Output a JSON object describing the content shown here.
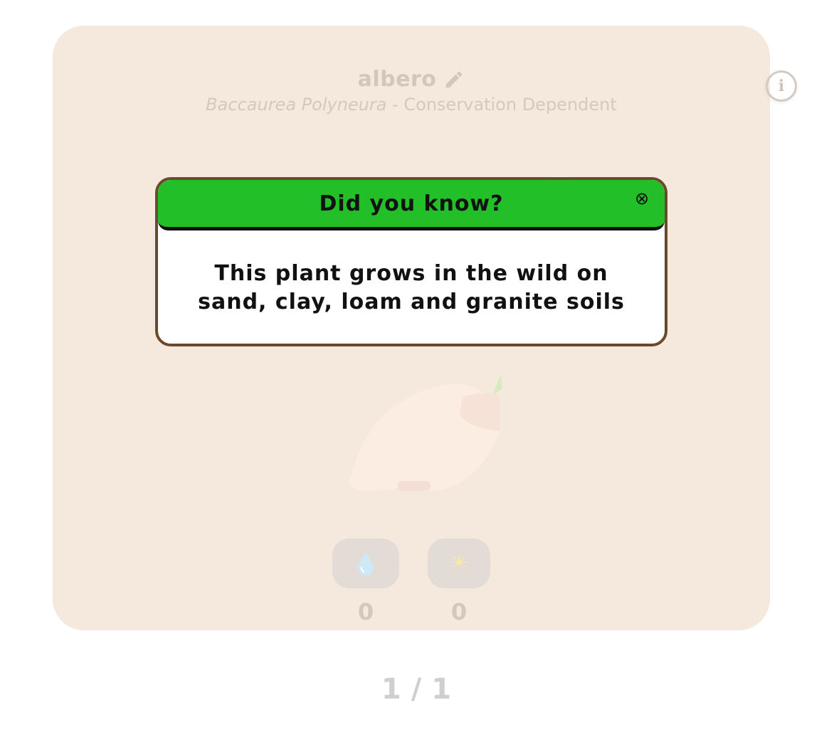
{
  "plant": {
    "name": "albero",
    "species": "Baccaurea Polyneura",
    "separator": " - ",
    "status": "Conservation Dependent",
    "info_label": "i"
  },
  "stats": {
    "water": {
      "icon": "water-drop-icon",
      "value": "0"
    },
    "sun": {
      "icon": "sun-icon",
      "glyph": "☀",
      "value": "0"
    }
  },
  "pager": {
    "current": "1",
    "separator": "/",
    "total": "1"
  },
  "dialog": {
    "title": "Did you know?",
    "close_glyph": "⊗",
    "message": "This plant grows in the wild on sand, clay, loam and granite soils"
  },
  "colors": {
    "card_background": "#f5e8dc",
    "dialog_header": "#22bf28",
    "dialog_border": "#6b4a2c"
  }
}
